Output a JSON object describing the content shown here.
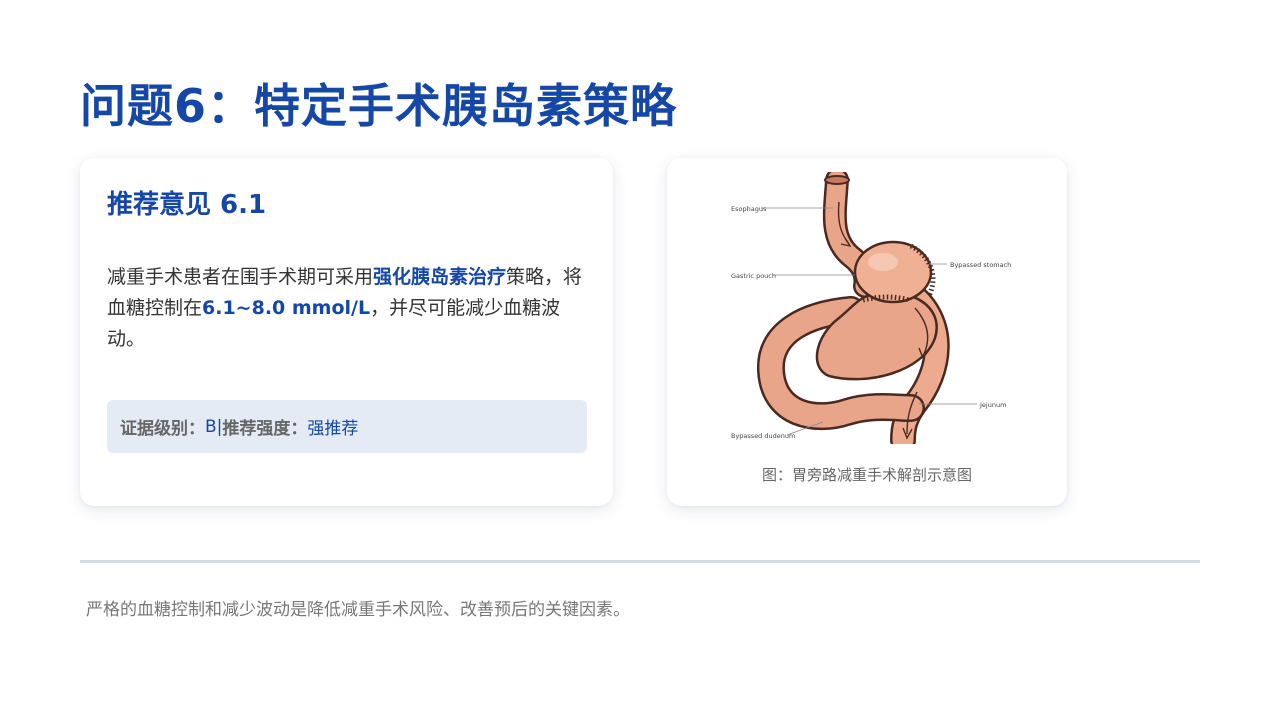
{
  "slide": {
    "title": "问题6：特定手术胰岛素策略"
  },
  "recommendation": {
    "heading": "推荐意见 6.1",
    "text_1": "减重手术患者在围手术期可采用",
    "highlight_1": "强化胰岛素治疗",
    "text_2": "策略，将血糖控制在",
    "highlight_2": "6.1~8.0 mmol/L",
    "text_3": "，并尽可能减少血糖波动。",
    "evidence_label": "证据级别：",
    "evidence_value": "B",
    "separator": "|",
    "strength_label": "推荐强度：",
    "strength_value": "强推荐"
  },
  "illustration": {
    "labels": {
      "esophagus": "Esophagus",
      "gastric_pouch": "Gastric pouch",
      "bypassed_stomach": "Bypassed stomach",
      "jejunum": "Jejunum",
      "bypassed_duodenum": "Bypassed dudenum"
    },
    "caption": "图：胃旁路减重手术解剖示意图"
  },
  "footer": {
    "note": "严格的血糖控制和减少波动是降低减重手术风险、改善预后的关键因素。"
  },
  "colors": {
    "accent": "#1447a6",
    "evidence_bg": "#e5ebf5",
    "organ": "#e8a58a",
    "organ_outline": "#4a2a20"
  }
}
